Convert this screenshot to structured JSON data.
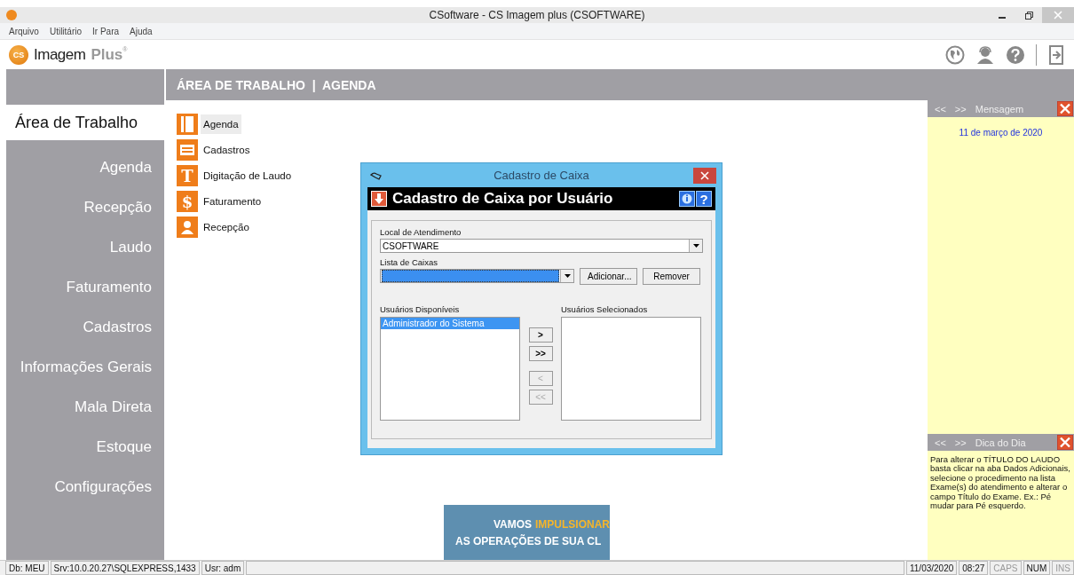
{
  "window": {
    "title": "CSoftware - CS Imagem plus (CSOFTWARE)"
  },
  "menu": [
    "Arquivo",
    "Utilitário",
    "Ir Para",
    "Ajuda"
  ],
  "logo": {
    "badge": "CS",
    "name": "Imagem",
    "suffix": "Plus",
    "mark": "®"
  },
  "breadcrumb": "ÁREA DE TRABALHO  |  AGENDA",
  "sidebar": {
    "items": [
      {
        "label": "Área de Trabalho",
        "selected": true
      },
      {
        "label": "Agenda",
        "selected": false
      },
      {
        "label": "Recepção",
        "selected": false
      },
      {
        "label": "Laudo",
        "selected": false
      },
      {
        "label": "Faturamento",
        "selected": false
      },
      {
        "label": "Cadastros",
        "selected": false
      },
      {
        "label": "Informações Gerais",
        "selected": false
      },
      {
        "label": "Mala Direta",
        "selected": false
      },
      {
        "label": "Estoque",
        "selected": false
      },
      {
        "label": "Configurações",
        "selected": false
      }
    ]
  },
  "shortcuts": [
    {
      "label": "Agenda",
      "kind": "book",
      "selected": true
    },
    {
      "label": "Cadastros",
      "kind": "cabinet",
      "selected": false
    },
    {
      "label": "Digitação de Laudo",
      "kind": "glyph",
      "glyph": "T",
      "selected": false
    },
    {
      "label": "Faturamento",
      "kind": "glyph",
      "glyph": "$",
      "selected": false
    },
    {
      "label": "Recepção",
      "kind": "person",
      "selected": false
    }
  ],
  "banner": {
    "lead": "VAMOS",
    "highlight": "IMPULSIONAR",
    "line2": "AS OPERAÇÕES DE SUA CL"
  },
  "dialog": {
    "title": "Cadastro de Caixa",
    "heading": "Cadastro de Caixa por Usuário",
    "help": "?",
    "local_label": "Local de Atendimento",
    "local_value": "CSOFTWARE",
    "lista_label": "Lista de Caixas",
    "buttons": [
      "Adicionar...",
      "Remover"
    ],
    "available_label": "Usuários Disponíveis",
    "available": [
      {
        "label": "Administrador do Sistema",
        "selected": true
      }
    ],
    "selected_label": "Usuários Selecionados",
    "move_buttons": [
      {
        "label": ">",
        "disabled": false
      },
      {
        "label": ">>",
        "disabled": false
      },
      {
        "label": "<",
        "disabled": true
      },
      {
        "label": "<<",
        "disabled": true
      }
    ]
  },
  "message_panel": {
    "prev": "<<",
    "next": ">>",
    "title": "Mensagem",
    "date": "11 de março de 2020"
  },
  "tip_panel": {
    "prev": "<<",
    "next": ">>",
    "title": "Dica do Dia",
    "text": "Para alterar o TÍTULO DO LAUDO basta clicar na aba Dados Adicionais, selecione o procedimento na lista Exame(s) do atendimento e alterar o campo Título do Exame. Ex.: Pé mudar para Pé esquerdo."
  },
  "status_left": [
    {
      "text": "Db: MEU",
      "disabled": false
    },
    {
      "text": "Srv:10.0.20.27\\SQLEXPRESS,1433",
      "disabled": false
    },
    {
      "text": "Usr: adm",
      "disabled": false
    }
  ],
  "status_right": [
    {
      "text": "11/03/2020",
      "disabled": false
    },
    {
      "text": "08:27",
      "disabled": false
    },
    {
      "text": "CAPS",
      "disabled": true
    },
    {
      "text": "NUM",
      "disabled": false
    },
    {
      "text": "INS",
      "disabled": true
    }
  ]
}
